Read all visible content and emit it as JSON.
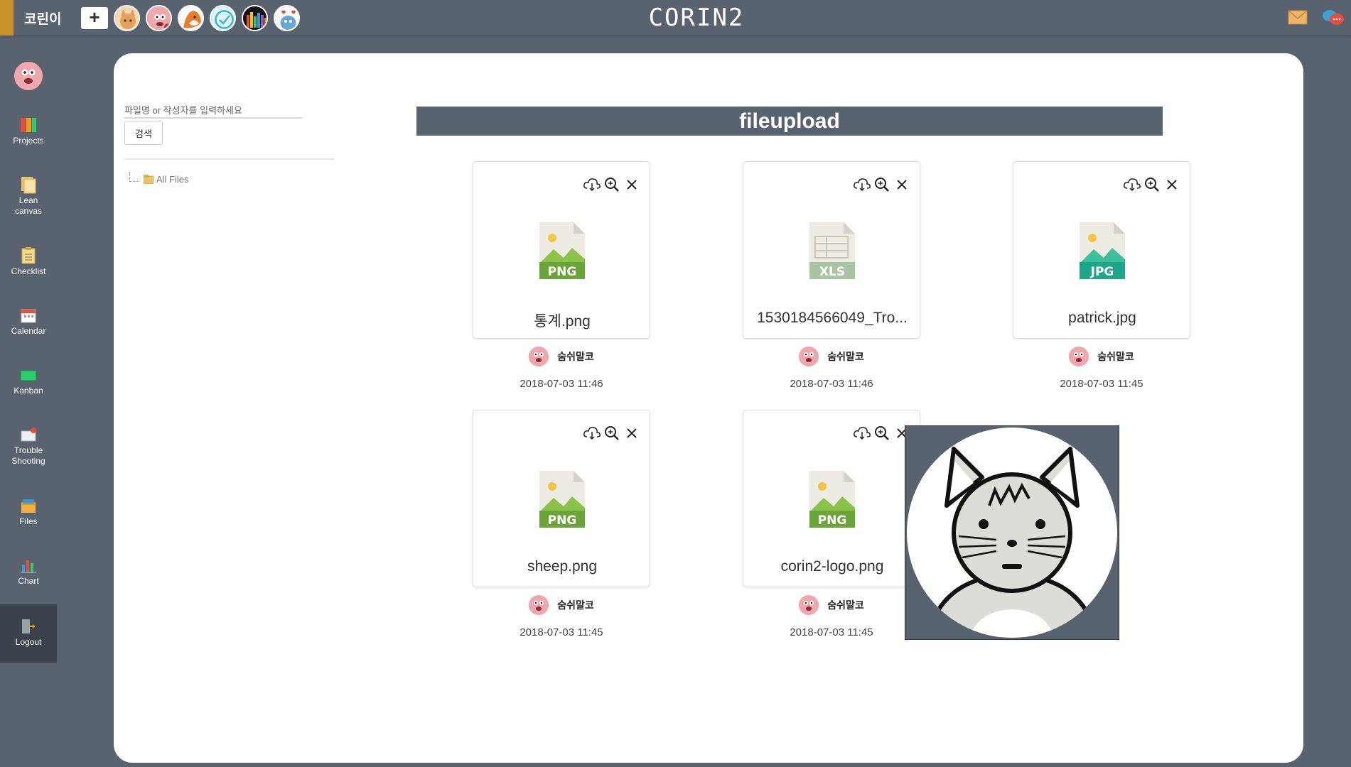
{
  "header": {
    "team_name": "코린이",
    "add_label": "+",
    "logo_text": "CORIN2",
    "members": [
      {
        "icon": "cat-avatar-icon",
        "color": "#e6a05a"
      },
      {
        "icon": "patrick-avatar-icon",
        "color": "#f0a7ac"
      },
      {
        "icon": "fox-avatar-icon",
        "color": "#e97d2a"
      },
      {
        "icon": "check-avatar-icon",
        "color": "#39b6c7"
      },
      {
        "icon": "bars-avatar-icon",
        "color": "#111111"
      },
      {
        "icon": "blue-creature-avatar-icon",
        "color": "#69a8d6"
      }
    ]
  },
  "sidebar": {
    "items": [
      {
        "label": "Projects",
        "icon": "projects-icon"
      },
      {
        "label": "Lean canvas",
        "icon": "lean-canvas-icon"
      },
      {
        "label": "Checklist",
        "icon": "checklist-icon"
      },
      {
        "label": "Calendar",
        "icon": "calendar-icon"
      },
      {
        "label": "Kanban",
        "icon": "kanban-icon"
      },
      {
        "label": "Trouble Shooting",
        "icon": "trouble-shooting-icon"
      },
      {
        "label": "Files",
        "icon": "files-icon"
      },
      {
        "label": "Chart",
        "icon": "chart-icon"
      },
      {
        "label": "Logout",
        "icon": "logout-icon"
      }
    ]
  },
  "search": {
    "placeholder": "파일명 or 작성자를 입력하세요",
    "button_label": "검색"
  },
  "tree": {
    "root_label": "All Files"
  },
  "main": {
    "title": "fileupload",
    "files": [
      {
        "name": "통계.png",
        "type": "PNG",
        "owner": "숨쉬말코",
        "date": "2018-07-03 11:46"
      },
      {
        "name": "1530184566049_Tro...",
        "type": "XLS",
        "owner": "숨쉬말코",
        "date": "2018-07-03 11:46"
      },
      {
        "name": "patrick.jpg",
        "type": "JPG",
        "owner": "숨쉬말코",
        "date": "2018-07-03 11:45"
      },
      {
        "name": "sheep.png",
        "type": "PNG",
        "owner": "숨쉬말코",
        "date": "2018-07-03 11:45"
      },
      {
        "name": "corin2-logo.png",
        "type": "PNG",
        "owner": "숨쉬말코",
        "date": "2018-07-03 11:45"
      }
    ]
  },
  "colors": {
    "background": "#59636f",
    "accent": "#c8912c",
    "png_green": "#6ba53a",
    "jpg_teal": "#1fa58a",
    "xls_gray": "#a9c3a3"
  }
}
